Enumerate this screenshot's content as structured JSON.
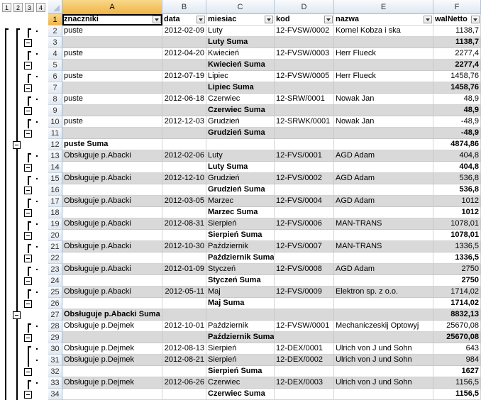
{
  "outline_levels": [
    "1",
    "2",
    "3",
    "4"
  ],
  "columns": [
    {
      "letter": "A"
    },
    {
      "letter": "B"
    },
    {
      "letter": "C"
    },
    {
      "letter": "D"
    },
    {
      "letter": "E"
    },
    {
      "letter": "F"
    }
  ],
  "headers": [
    "znaczniki",
    "data",
    "miesiac",
    "kod",
    "nazwa",
    "walNetto"
  ],
  "rows": [
    {
      "n": "2",
      "a": "puste",
      "b": "2012-02-09",
      "c": "Luty",
      "d": "12-FVSW/0002",
      "e": "Kornel Kobza i ska",
      "f": "1138,7",
      "t": "d"
    },
    {
      "n": "3",
      "a": "",
      "b": "",
      "c": "Luty Suma",
      "d": "",
      "e": "",
      "f": "1138,7",
      "t": "m"
    },
    {
      "n": "4",
      "a": "puste",
      "b": "2012-04-20",
      "c": "Kwiecień",
      "d": "12-FVSW/0003",
      "e": "Herr Flueck",
      "f": "2277,4",
      "t": "d"
    },
    {
      "n": "5",
      "a": "",
      "b": "",
      "c": "Kwiecień Suma",
      "d": "",
      "e": "",
      "f": "2277,4",
      "t": "m"
    },
    {
      "n": "6",
      "a": "puste",
      "b": "2012-07-19",
      "c": "Lipiec",
      "d": "12-FVSW/0005",
      "e": "Herr Flueck",
      "f": "1458,76",
      "t": "d"
    },
    {
      "n": "7",
      "a": "",
      "b": "",
      "c": "Lipiec Suma",
      "d": "",
      "e": "",
      "f": "1458,76",
      "t": "m"
    },
    {
      "n": "8",
      "a": "puste",
      "b": "2012-06-18",
      "c": "Czerwiec",
      "d": "12-SRW/0001",
      "e": "Nowak Jan",
      "f": "48,9",
      "t": "d"
    },
    {
      "n": "9",
      "a": "",
      "b": "",
      "c": "Czerwiec Suma",
      "d": "",
      "e": "",
      "f": "48,9",
      "t": "m"
    },
    {
      "n": "10",
      "a": "puste",
      "b": "2012-12-03",
      "c": "Grudzień",
      "d": "12-SRWK/0001",
      "e": "Nowak Jan",
      "f": "-48,9",
      "t": "d"
    },
    {
      "n": "11",
      "a": "",
      "b": "",
      "c": "Grudzień Suma",
      "d": "",
      "e": "",
      "f": "-48,9",
      "t": "m"
    },
    {
      "n": "12",
      "a": "puste Suma",
      "b": "",
      "c": "",
      "d": "",
      "e": "",
      "f": "4874,86",
      "t": "g"
    },
    {
      "n": "13",
      "a": "Obsługuje p.Abacki",
      "b": "2012-02-06",
      "c": "Luty",
      "d": "12-FVS/0001",
      "e": "AGD Adam",
      "f": "404,8",
      "t": "d"
    },
    {
      "n": "14",
      "a": "",
      "b": "",
      "c": "Luty Suma",
      "d": "",
      "e": "",
      "f": "404,8",
      "t": "m"
    },
    {
      "n": "15",
      "a": "Obsługuje p.Abacki",
      "b": "2012-12-10",
      "c": "Grudzień",
      "d": "12-FVS/0002",
      "e": "AGD Adam",
      "f": "536,8",
      "t": "d"
    },
    {
      "n": "16",
      "a": "",
      "b": "",
      "c": "Grudzień Suma",
      "d": "",
      "e": "",
      "f": "536,8",
      "t": "m"
    },
    {
      "n": "17",
      "a": "Obsługuje p.Abacki",
      "b": "2012-03-05",
      "c": "Marzec",
      "d": "12-FVS/0004",
      "e": "AGD Adam",
      "f": "1012",
      "t": "d"
    },
    {
      "n": "18",
      "a": "",
      "b": "",
      "c": "Marzec Suma",
      "d": "",
      "e": "",
      "f": "1012",
      "t": "m"
    },
    {
      "n": "19",
      "a": "Obsługuje p.Abacki",
      "b": "2012-08-31",
      "c": "Sierpień",
      "d": "12-FVS/0006",
      "e": "MAN-TRANS",
      "f": "1078,01",
      "t": "d"
    },
    {
      "n": "20",
      "a": "",
      "b": "",
      "c": "Sierpień Suma",
      "d": "",
      "e": "",
      "f": "1078,01",
      "t": "m"
    },
    {
      "n": "21",
      "a": "Obsługuje p.Abacki",
      "b": "2012-10-30",
      "c": "Październik",
      "d": "12-FVS/0007",
      "e": "MAN-TRANS",
      "f": "1336,5",
      "t": "d"
    },
    {
      "n": "22",
      "a": "",
      "b": "",
      "c": "Październik Suma",
      "d": "",
      "e": "",
      "f": "1336,5",
      "t": "m"
    },
    {
      "n": "23",
      "a": "Obsługuje p.Abacki",
      "b": "2012-01-09",
      "c": "Styczeń",
      "d": "12-FVS/0008",
      "e": "AGD Adam",
      "f": "2750",
      "t": "d"
    },
    {
      "n": "24",
      "a": "",
      "b": "",
      "c": "Styczeń Suma",
      "d": "",
      "e": "",
      "f": "2750",
      "t": "m"
    },
    {
      "n": "25",
      "a": "Obsługuje p.Abacki",
      "b": "2012-05-11",
      "c": "Maj",
      "d": "12-FVS/0009",
      "e": "Elektron sp. z o.o.",
      "f": "1714,02",
      "t": "d"
    },
    {
      "n": "26",
      "a": "",
      "b": "",
      "c": "Maj Suma",
      "d": "",
      "e": "",
      "f": "1714,02",
      "t": "m"
    },
    {
      "n": "27",
      "a": "Obsługuje p.Abacki Suma",
      "b": "",
      "c": "",
      "d": "",
      "e": "",
      "f": "8832,13",
      "t": "g"
    },
    {
      "n": "28",
      "a": "Obsługuje p.Dejmek",
      "b": "2012-10-01",
      "c": "Październik",
      "d": "12-FVSW/0001",
      "e": "Mechaniczeskij Optowyj",
      "f": "25670,08",
      "t": "d"
    },
    {
      "n": "29",
      "a": "",
      "b": "",
      "c": "Październik Suma",
      "d": "",
      "e": "",
      "f": "25670,08",
      "t": "m"
    },
    {
      "n": "30",
      "a": "Obsługuje p.Dejmek",
      "b": "2012-08-13",
      "c": "Sierpień",
      "d": "12-DEX/0001",
      "e": "Ulrich von J und Sohn",
      "f": "643",
      "t": "d"
    },
    {
      "n": "31",
      "a": "Obsługuje p.Dejmek",
      "b": "2012-08-21",
      "c": "Sierpień",
      "d": "12-DEX/0002",
      "e": "Ulrich von J und Sohn",
      "f": "984",
      "t": "d"
    },
    {
      "n": "32",
      "a": "",
      "b": "",
      "c": "Sierpień Suma",
      "d": "",
      "e": "",
      "f": "1627",
      "t": "m"
    },
    {
      "n": "33",
      "a": "Obsługuje p.Dejmek",
      "b": "2012-06-26",
      "c": "Czerwiec",
      "d": "12-DEX/0003",
      "e": "Ulrich von J und Sohn",
      "f": "1156,5",
      "t": "d"
    },
    {
      "n": "34",
      "a": "",
      "b": "",
      "c": "Czerwiec Suma",
      "d": "",
      "e": "",
      "f": "1156,5",
      "t": "m"
    }
  ]
}
